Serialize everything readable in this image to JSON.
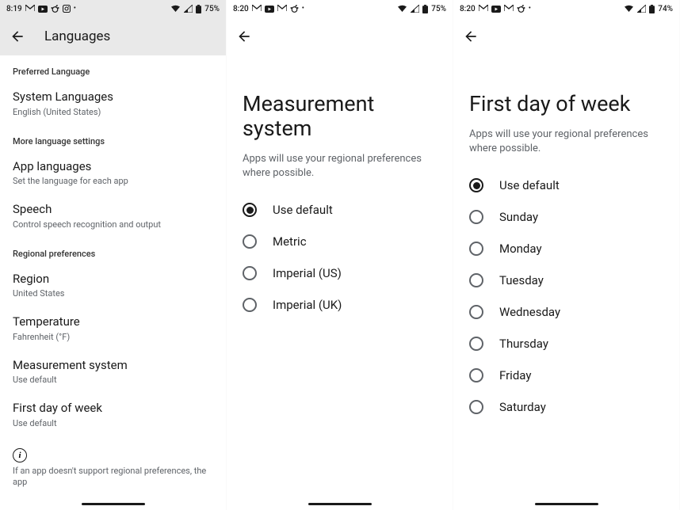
{
  "panel1": {
    "status": {
      "time": "8:19",
      "battery": "75%"
    },
    "header_title": "Languages",
    "sections": {
      "preferred": {
        "header": "Preferred Language",
        "system_languages": {
          "title": "System Languages",
          "sub": "English (United States)"
        }
      },
      "more": {
        "header": "More language settings",
        "app_languages": {
          "title": "App languages",
          "sub": "Set the language for each app"
        },
        "speech": {
          "title": "Speech",
          "sub": "Control speech recognition and output"
        }
      },
      "regional": {
        "header": "Regional preferences",
        "region": {
          "title": "Region",
          "sub": "United States"
        },
        "temperature": {
          "title": "Temperature",
          "sub": "Fahrenheit (°F)"
        },
        "measurement": {
          "title": "Measurement system",
          "sub": "Use default"
        },
        "first_day": {
          "title": "First day of week",
          "sub": "Use default"
        }
      }
    },
    "footnote": "If an app doesn't support regional preferences, the app"
  },
  "panel2": {
    "status": {
      "time": "8:20",
      "battery": "75%"
    },
    "title": "Measurement system",
    "subtitle": "Apps will use your regional preferences where possible.",
    "options": [
      {
        "label": "Use default",
        "selected": true
      },
      {
        "label": "Metric",
        "selected": false
      },
      {
        "label": "Imperial (US)",
        "selected": false
      },
      {
        "label": "Imperial (UK)",
        "selected": false
      }
    ]
  },
  "panel3": {
    "status": {
      "time": "8:20",
      "battery": "74%"
    },
    "title": "First day of week",
    "subtitle": "Apps will use your regional preferences where possible.",
    "options": [
      {
        "label": "Use default",
        "selected": true
      },
      {
        "label": "Sunday",
        "selected": false
      },
      {
        "label": "Monday",
        "selected": false
      },
      {
        "label": "Tuesday",
        "selected": false
      },
      {
        "label": "Wednesday",
        "selected": false
      },
      {
        "label": "Thursday",
        "selected": false
      },
      {
        "label": "Friday",
        "selected": false
      },
      {
        "label": "Saturday",
        "selected": false
      }
    ]
  }
}
